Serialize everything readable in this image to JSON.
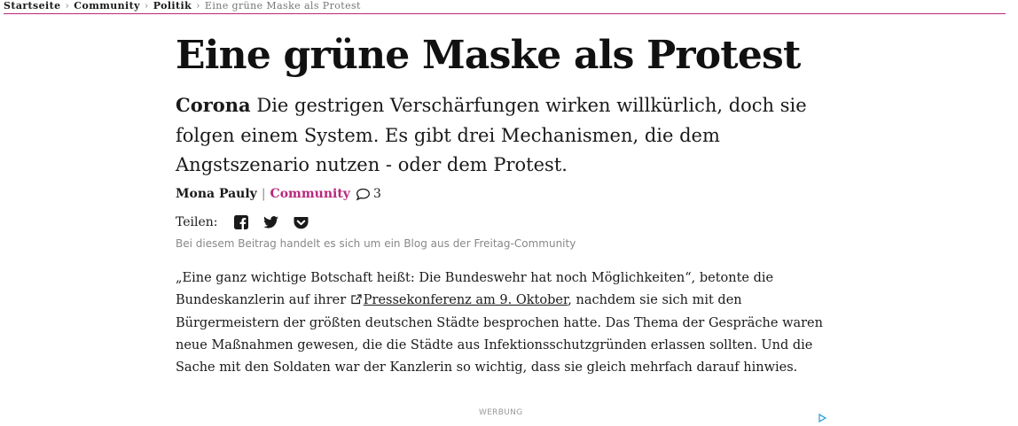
{
  "breadcrumb": {
    "items": [
      "Startseite",
      "Community",
      "Politik"
    ],
    "current": "Eine grüne Maske als Protest"
  },
  "article": {
    "title": "Eine grüne Maske als Protest",
    "kicker": "Corona",
    "lead": "Die gestrigen Verschärfungen wirken willkürlich, doch sie folgen einem System. Es gibt drei Mechanismen, die dem Angstszenario nutzen - oder dem Protest.",
    "author": "Mona Pauly",
    "section": "Community",
    "comment_count": "3",
    "share_label": "Teilen:",
    "share_icons": [
      "facebook-icon",
      "twitter-icon",
      "pocket-icon"
    ],
    "blog_note": "Bei diesem Beitrag handelt es sich um ein Blog aus der Freitag-Community",
    "body_p1_before": "„Eine ganz wichtige Botschaft heißt: Die Bundeswehr hat noch Möglichkeiten“, betonte die Bundeskanzlerin auf ihrer ",
    "body_link": "Pressekonferenz am 9. Oktober",
    "body_p1_after": ", nachdem sie sich mit den Bürgermeistern der größten deutschen Städte besprochen hatte. Das Thema der Gespräche waren neue Maßnahmen gewesen, die die Städte aus Infektionsschutzgründen erlassen sollten. Und die Sache mit den Soldaten war der Kanzlerin so wichtig, dass sie gleich mehrfach darauf hinwies."
  },
  "ad": {
    "label": "WERBUNG"
  },
  "colors": {
    "accent": "#b9287c",
    "text": "#1a1a1a",
    "muted": "#888888"
  }
}
